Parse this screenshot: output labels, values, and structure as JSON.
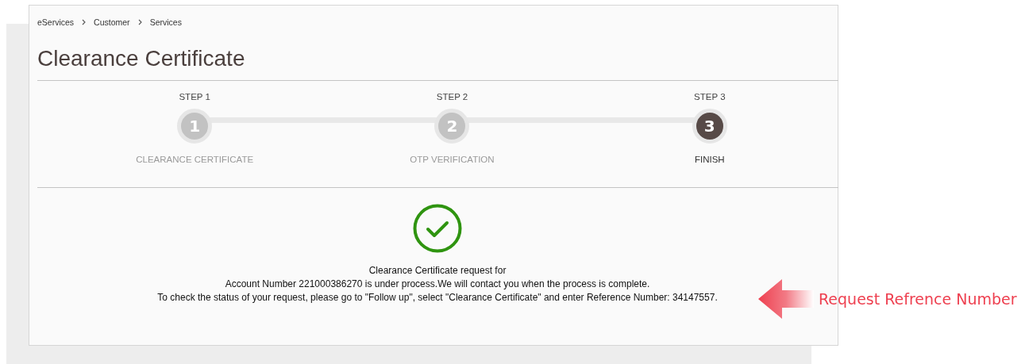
{
  "breadcrumbs": [
    "eServices",
    "Customer",
    "Services"
  ],
  "title": "Clearance Certificate",
  "steps": [
    {
      "heading": "STEP 1",
      "number": "1",
      "name": "CLEARANCE CERTIFICATE",
      "current": false
    },
    {
      "heading": "STEP 2",
      "number": "2",
      "name": "OTP VERIFICATION",
      "current": false
    },
    {
      "heading": "STEP 3",
      "number": "3",
      "name": "FINISH",
      "current": true
    }
  ],
  "message": [
    "Clearance Certificate request for",
    "Account Number 221000386270 is under process.We will contact you when the process is complete.",
    "To check the status of your request, please go to \"Follow up\", select \"Clearance Certificate\" and enter Reference Number: 34147557."
  ],
  "annotation": {
    "label": "Request Refrence Number"
  }
}
